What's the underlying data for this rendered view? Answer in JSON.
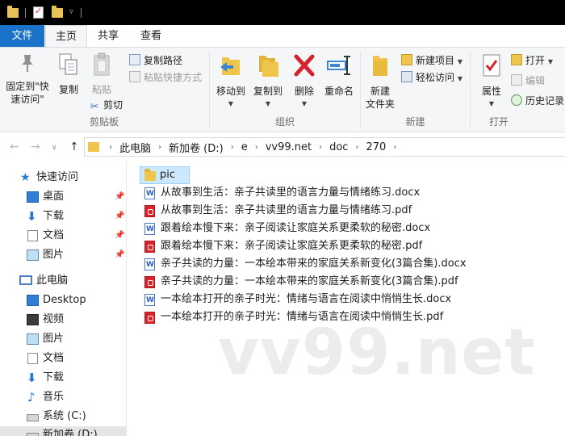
{
  "ribbon_tabs": {
    "file": "文件",
    "home": "主页",
    "share": "共享",
    "view": "查看"
  },
  "clipboard": {
    "pin_label_1": "固定到\"快",
    "pin_label_2": "速访问\"",
    "copy": "复制",
    "paste": "粘贴",
    "copy_path": "复制路径",
    "paste_shortcut": "粘贴快捷方式",
    "cut": "剪切",
    "group": "剪贴板"
  },
  "organize": {
    "move_to": "移动到",
    "copy_to": "复制到",
    "delete": "删除",
    "rename": "重命名",
    "group": "组织"
  },
  "new_group": {
    "new_folder_1": "新建",
    "new_folder_2": "文件夹",
    "new_item": "新建项目",
    "easy_access": "轻松访问",
    "group": "新建"
  },
  "open_group": {
    "properties": "属性",
    "open": "打开",
    "edit": "编辑",
    "history": "历史记录",
    "group": "打开"
  },
  "breadcrumbs": [
    "此电脑",
    "新加卷 (D:)",
    "e",
    "vv99.net",
    "doc",
    "270"
  ],
  "nav": {
    "quick_access": "快速访问",
    "desktop_cn": "桌面",
    "downloads_cn": "下载",
    "documents_cn": "文档",
    "pictures_cn": "图片",
    "this_pc": "此电脑",
    "desktop": "Desktop",
    "videos": "视频",
    "pictures": "图片",
    "documents": "文档",
    "downloads": "下载",
    "music": "音乐",
    "system_c": "系统 (C:)",
    "new_volume_d": "新加卷 (D:)"
  },
  "files": [
    {
      "name": "pic",
      "type": "folder"
    },
    {
      "name": "从故事到生活：亲子共读里的语言力量与情绪练习.docx",
      "type": "docx"
    },
    {
      "name": "从故事到生活：亲子共读里的语言力量与情绪练习.pdf",
      "type": "pdf"
    },
    {
      "name": "跟着绘本慢下来：亲子阅读让家庭关系更柔软的秘密.docx",
      "type": "docx"
    },
    {
      "name": "跟着绘本慢下来：亲子阅读让家庭关系更柔软的秘密.pdf",
      "type": "pdf"
    },
    {
      "name": "亲子共读的力量：一本绘本带来的家庭关系新变化(3篇合集).docx",
      "type": "docx"
    },
    {
      "name": "亲子共读的力量：一本绘本带来的家庭关系新变化(3篇合集).pdf",
      "type": "pdf"
    },
    {
      "name": "一本绘本打开的亲子时光：情绪与语言在阅读中悄悄生长.docx",
      "type": "docx"
    },
    {
      "name": "一本绘本打开的亲子时光：情绪与语言在阅读中悄悄生长.pdf",
      "type": "pdf"
    }
  ],
  "watermark": "vv99.net",
  "colors": {
    "accent": "#1a73c9",
    "selection": "#cce8ff",
    "folder": "#f0c54b",
    "pdf": "#d8232a"
  }
}
